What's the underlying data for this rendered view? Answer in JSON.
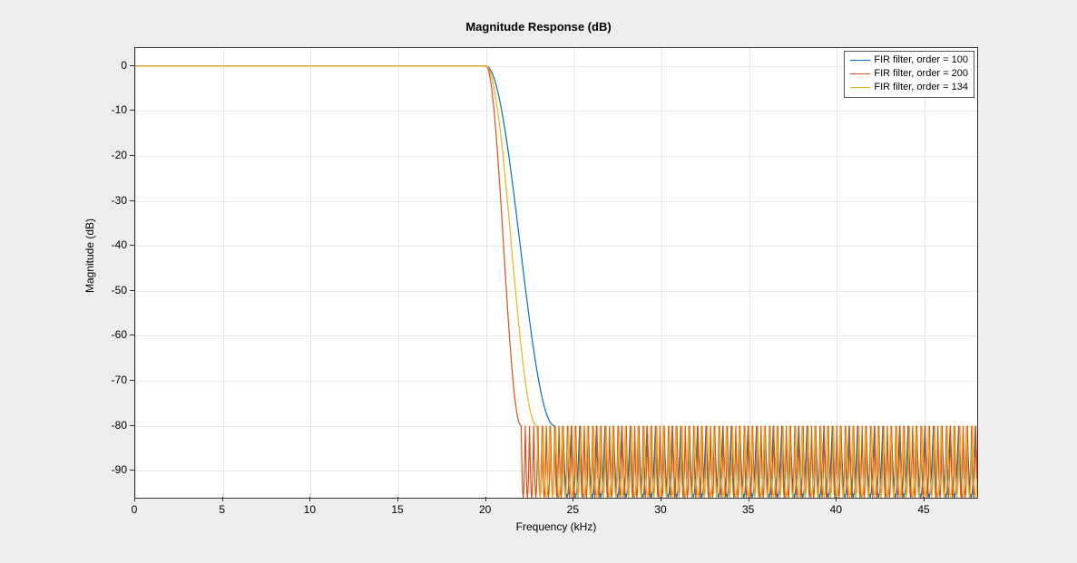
{
  "title": "Magnitude Response (dB)",
  "xlabel": "Frequency (kHz)",
  "ylabel": "Magnitude (dB)",
  "colors": {
    "s1": "#0072BD",
    "s2": "#D95319",
    "s3": "#EDB120"
  },
  "legend": {
    "s1": "FIR filter, order = 100",
    "s2": "FIR filter, order = 200",
    "s3": "FIR filter, order = 134"
  },
  "chart_data": {
    "type": "line",
    "xlim": [
      0,
      48
    ],
    "ylim": [
      -96,
      4
    ],
    "xticks": [
      0,
      5,
      10,
      15,
      20,
      25,
      30,
      35,
      40,
      45
    ],
    "yticks": [
      0,
      -10,
      -20,
      -30,
      -40,
      -50,
      -60,
      -70,
      -80,
      -90
    ],
    "grid": true,
    "legend_position": "top-right",
    "series": [
      {
        "name": "FIR filter, order = 100",
        "color": "#0072BD",
        "passband_end_khz": 20.0,
        "cutoff_80dB_khz": 23.9,
        "stopband_ripple_top_db": -80,
        "stopband_ripple_bottom_db": -96,
        "approx_ripple_period_khz": 0.96
      },
      {
        "name": "FIR filter, order = 200",
        "color": "#D95319",
        "passband_end_khz": 20.0,
        "cutoff_80dB_khz": 22.0,
        "stopband_ripple_top_db": -80,
        "stopband_ripple_bottom_db": -96,
        "approx_ripple_period_khz": 0.48
      },
      {
        "name": "FIR filter, order = 134",
        "color": "#EDB120",
        "passband_end_khz": 20.0,
        "cutoff_80dB_khz": 22.9,
        "stopband_ripple_top_db": -80,
        "stopband_ripple_bottom_db": -96,
        "approx_ripple_period_khz": 0.72
      }
    ]
  }
}
